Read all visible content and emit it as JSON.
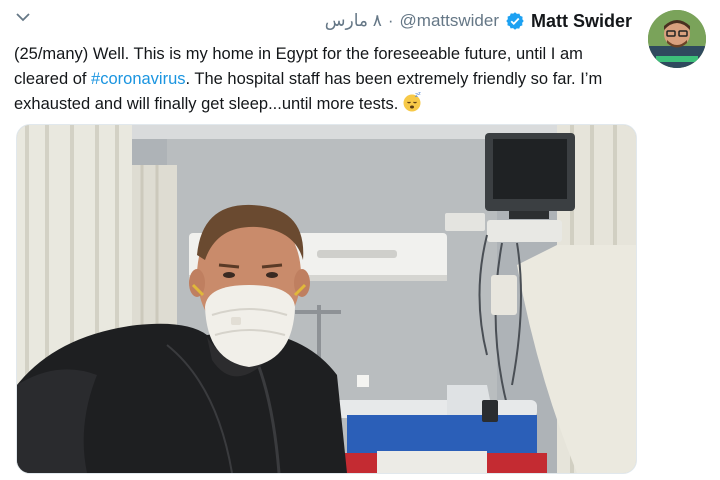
{
  "tweet": {
    "author_name": "Matt Swider",
    "handle": "@mattswider",
    "date": "٨ مارس",
    "separator": "·",
    "text_before": "(25/many) Well. This is my home in Egypt for the foreseeable future, until I am cleared of ",
    "hashtag": "#coronavirus",
    "text_after": ". The hospital staff has been extremely friendly so far. I’m exhausted and will finally get sleep...until more tests.",
    "emoji": "sleeping-face",
    "photo_icon": "hospital-selfie-photo"
  },
  "colors": {
    "link": "#1b95e0",
    "verified": "#1da1f2",
    "muted": "#657786"
  },
  "icons": [
    "chevron-down-icon",
    "verified-badge-icon",
    "sleeping-face-emoji"
  ]
}
